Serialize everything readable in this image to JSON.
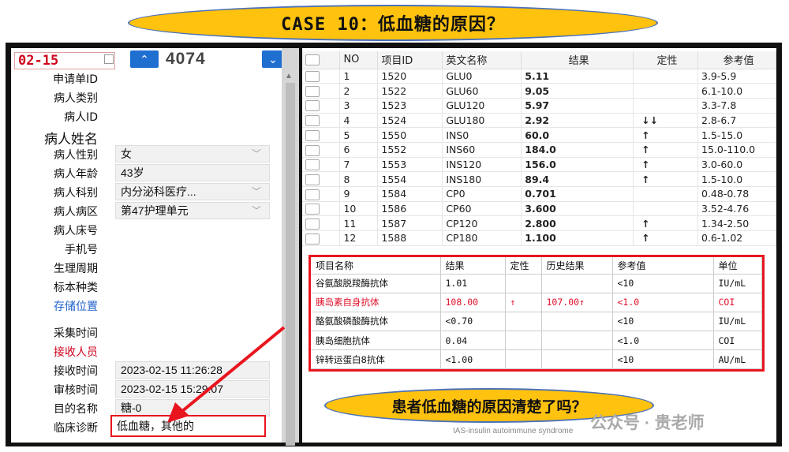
{
  "banner": {
    "title": "CASE 10：低血糖的原因？"
  },
  "header": {
    "date": "02-15",
    "count": "4074",
    "up_symbol": "^",
    "down_symbol": "v"
  },
  "fields": [
    {
      "label": "申请单ID",
      "value": ""
    },
    {
      "label": "病人类别",
      "value": ""
    },
    {
      "label": "病人ID",
      "value": ""
    },
    {
      "label": "病人姓名",
      "value": ""
    },
    {
      "label": "病人性别",
      "value": "女"
    },
    {
      "label": "病人年龄",
      "value": "43岁"
    },
    {
      "label": "病人科别",
      "value": "内分泌科医疗..."
    },
    {
      "label": "病人病区",
      "value": "第47护理单元"
    },
    {
      "label": "病人床号",
      "value": ""
    },
    {
      "label": "手机号",
      "value": ""
    },
    {
      "label": "生理周期",
      "value": ""
    },
    {
      "label": "标本种类",
      "value": ""
    },
    {
      "label": "存储位置",
      "value": ""
    },
    {
      "label": "采集时间",
      "value": ""
    },
    {
      "label": "接收人员",
      "value": ""
    },
    {
      "label": "接收时间",
      "value": "2023-02-15 11:26:28"
    },
    {
      "label": "审核时间",
      "value": "2023-02-15 15:29:07"
    },
    {
      "label": "目的名称",
      "value": "糖-0"
    },
    {
      "label": "临床诊断",
      "value": "低血糖，其他的"
    }
  ],
  "results_table": {
    "columns": [
      "NO",
      "项目ID",
      "英文名称",
      "结果",
      "定性",
      "参考值"
    ],
    "rows": [
      {
        "no": "1",
        "id": "1520",
        "name": "GLU0",
        "result": "5.11",
        "flag": "",
        "ref": "3.9-5.9",
        "color": "normal"
      },
      {
        "no": "2",
        "id": "1522",
        "name": "GLU60",
        "result": "9.05",
        "flag": "",
        "ref": "6.1-10.0",
        "color": "normal"
      },
      {
        "no": "3",
        "id": "1523",
        "name": "GLU120",
        "result": "5.97",
        "flag": "",
        "ref": "3.3-7.8",
        "color": "normal"
      },
      {
        "no": "4",
        "id": "1524",
        "name": "GLU180",
        "result": "2.92",
        "flag": "↓↓",
        "ref": "2.8-6.7",
        "color": "green"
      },
      {
        "no": "5",
        "id": "1550",
        "name": "INS0",
        "result": "60.0",
        "flag": "↑",
        "ref": "1.5-15.0",
        "color": "red"
      },
      {
        "no": "6",
        "id": "1552",
        "name": "INS60",
        "result": "184.0",
        "flag": "↑",
        "ref": "15.0-110.0",
        "color": "red"
      },
      {
        "no": "7",
        "id": "1553",
        "name": "INS120",
        "result": "156.0",
        "flag": "↑",
        "ref": "3.0-60.0",
        "color": "red"
      },
      {
        "no": "8",
        "id": "1554",
        "name": "INS180",
        "result": "89.4",
        "flag": "↑",
        "ref": "1.5-10.0",
        "color": "red"
      },
      {
        "no": "9",
        "id": "1584",
        "name": "CP0",
        "result": "0.701",
        "flag": "",
        "ref": "0.48-0.78",
        "color": "normal"
      },
      {
        "no": "10",
        "id": "1586",
        "name": "CP60",
        "result": "3.600",
        "flag": "",
        "ref": "3.52-4.76",
        "color": "normal"
      },
      {
        "no": "11",
        "id": "1587",
        "name": "CP120",
        "result": "2.800",
        "flag": "↑",
        "ref": "1.34-2.50",
        "color": "red"
      },
      {
        "no": "12",
        "id": "1588",
        "name": "CP180",
        "result": "1.100",
        "flag": "↑",
        "ref": "0.6-1.02",
        "color": "red"
      }
    ]
  },
  "antibody_table": {
    "columns": [
      "项目名称",
      "结果",
      "定性",
      "历史结果",
      "参考值",
      "单位"
    ],
    "rows": [
      {
        "name": "谷氨酸脱羧酶抗体",
        "result": "1.01",
        "flag": "",
        "history": "",
        "ref": "<10",
        "unit": "IU/mL",
        "highlight": false
      },
      {
        "name": "胰岛素自身抗体",
        "result": "108.00",
        "flag": "↑",
        "history": "107.00↑",
        "ref": "<1.0",
        "unit": "COI",
        "highlight": true
      },
      {
        "name": "酪氨酸磷酸酶抗体",
        "result": "<0.70",
        "flag": "",
        "history": "",
        "ref": "<10",
        "unit": "IU/mL",
        "highlight": false
      },
      {
        "name": "胰岛细胞抗体",
        "result": "0.04",
        "flag": "",
        "history": "",
        "ref": "<1.0",
        "unit": "COI",
        "highlight": false
      },
      {
        "name": "锌转运蛋白8抗体",
        "result": "<1.00",
        "flag": "",
        "history": "",
        "ref": "<10",
        "unit": "AU/mL",
        "highlight": false
      }
    ]
  },
  "question": "患者低血糖的原因清楚了吗？",
  "watermark": "公众号 · 贵老师",
  "note": "IAS-insulin autoimmune syndrome",
  "colors": {
    "accent": "#ffc20e",
    "alert": "#e8151f",
    "primary_button": "#1f6fd1",
    "low_flag": "#1fc71f"
  }
}
